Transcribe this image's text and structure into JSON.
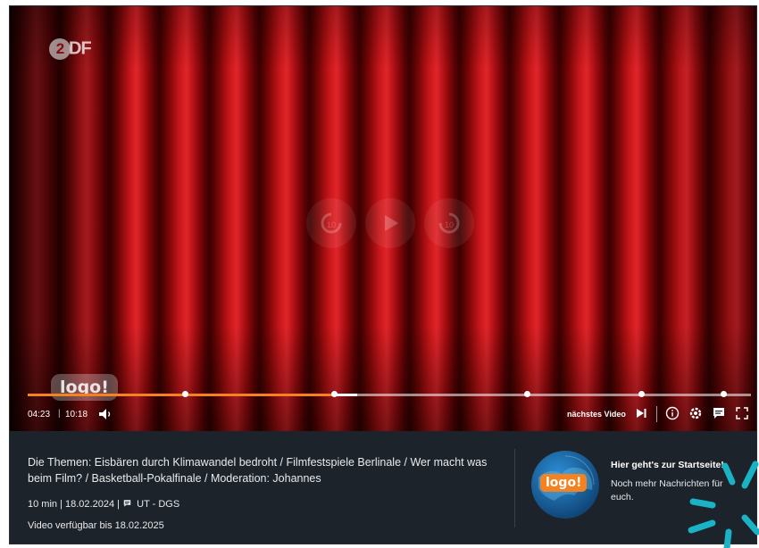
{
  "player": {
    "channel_logo": "2DF",
    "watermark": "logo!",
    "time_current": "04:23",
    "time_separator": "|",
    "time_total": "10:18",
    "next_video_label": "nächstes Video",
    "progress_fraction": 0.424,
    "buffered_fraction": 0.455,
    "chapter_marker_fractions": [
      0.0,
      0.217,
      0.424,
      0.69,
      0.848,
      0.962
    ],
    "icons": [
      "replay-10-icon",
      "play-icon",
      "forward-10-icon",
      "volume-icon",
      "skip-next-icon",
      "info-icon",
      "settings-icon",
      "subtitles-icon",
      "fullscreen-icon"
    ]
  },
  "info": {
    "title": "Die Themen: Eisbären durch Klimawandel bedroht / Filmfestspiele Berlinale / Wer macht was beim Film? / Basketball-Pokalfinale / Moderation: Johannes",
    "duration": "10 min",
    "date": "18.02.2024",
    "accessibility": "UT - DGS",
    "availability": "Video verfügbar bis 18.02.2025"
  },
  "teaser": {
    "badge": "logo!",
    "title": "Hier geht's zur Startseite!",
    "subtitle": "Noch mehr Nachrichten für euch."
  },
  "colors": {
    "accent": "#f58220",
    "background": "#1d232a",
    "curtain": "#c8161a",
    "burst": "#1ab3c6"
  }
}
